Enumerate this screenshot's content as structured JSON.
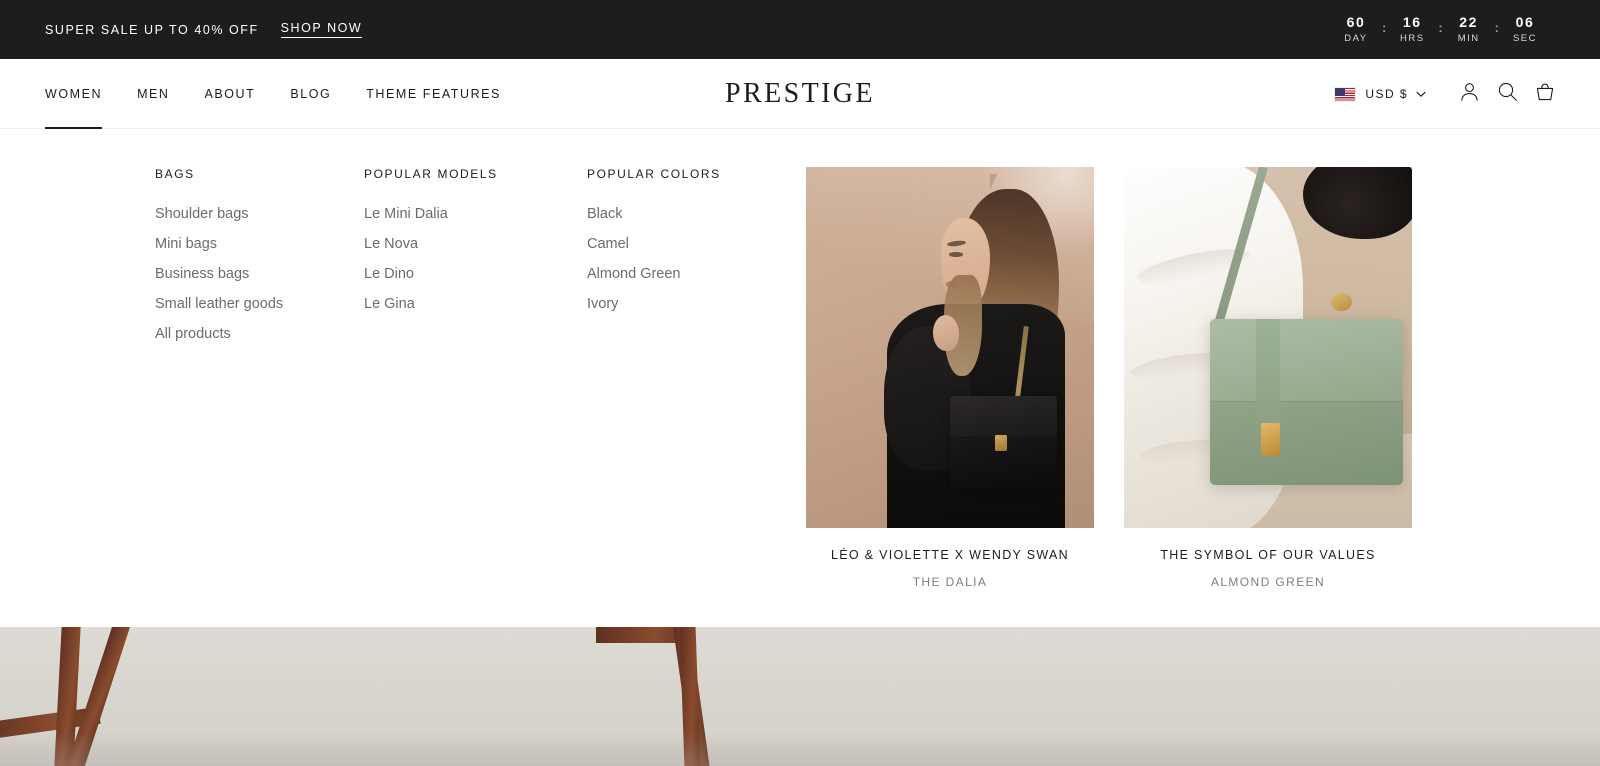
{
  "announcement": {
    "message": "SUPER SALE UP TO 40% OFF",
    "cta_label": "SHOP NOW",
    "separator": ":",
    "countdown": [
      {
        "value": "60",
        "unit": "DAY"
      },
      {
        "value": "16",
        "unit": "HRS"
      },
      {
        "value": "22",
        "unit": "MIN"
      },
      {
        "value": "06",
        "unit": "SEC"
      }
    ]
  },
  "header": {
    "logo": "PRESTIGE",
    "nav": [
      {
        "label": "WOMEN",
        "active": true
      },
      {
        "label": "MEN",
        "active": false
      },
      {
        "label": "ABOUT",
        "active": false
      },
      {
        "label": "BLOG",
        "active": false
      },
      {
        "label": "THEME FEATURES",
        "active": false
      }
    ],
    "currency": {
      "label": "USD $",
      "flag_icon": "us-flag-icon",
      "chevron_icon": "chevron-down-icon"
    },
    "icons": {
      "account": "user-icon",
      "search": "search-icon",
      "cart": "shopping-basket-icon"
    }
  },
  "mega_menu": {
    "columns": [
      {
        "title": "BAGS",
        "links": [
          "Shoulder bags",
          "Mini bags",
          "Business bags",
          "Small leather goods",
          "All products"
        ]
      },
      {
        "title": "POPULAR MODELS",
        "links": [
          "Le Mini Dalia",
          "Le Nova",
          "Le Dino",
          "Le Gina"
        ]
      },
      {
        "title": "POPULAR COLORS",
        "links": [
          "Black",
          "Camel",
          "Almond Green",
          "Ivory"
        ]
      }
    ],
    "promos": [
      {
        "title": "LÉO & VIOLETTE X WENDY SWAN",
        "subtitle": "THE DALIA",
        "image_alt": "woman-with-black-shoulder-bag"
      },
      {
        "title": "THE SYMBOL OF OUR VALUES",
        "subtitle": "ALMOND GREEN",
        "image_alt": "almond-green-bag-on-white-sweater"
      }
    ]
  },
  "hero": {
    "image_alt": "wooden-chair-legs-on-greige-background"
  },
  "colors": {
    "announcement_bg": "#1d1d1d",
    "text_primary": "#1d1d1d",
    "text_muted": "#6b6b6b",
    "page_bg": "#ffffff",
    "border": "#ececec"
  }
}
